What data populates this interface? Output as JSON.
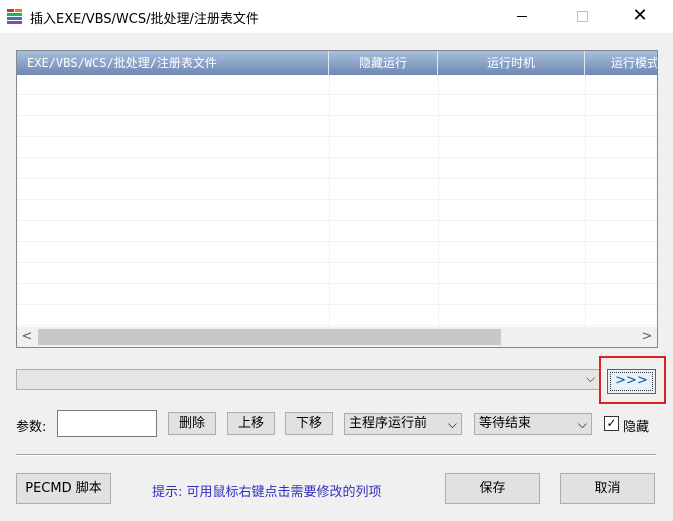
{
  "window": {
    "title": "插入EXE/VBS/WCS/批处理/注册表文件",
    "icon": "app-file-stack-icon",
    "controls": {
      "minimize": "minimize-icon",
      "maximize": "maximize-icon",
      "close": "close-icon",
      "close_glyph": "✕"
    }
  },
  "list": {
    "columns": [
      "EXE/VBS/WCS/批处理/注册表文件",
      "隐藏运行",
      "运行时机",
      "运行模式"
    ],
    "rows": [],
    "header_color": "#6d87b3",
    "scroll_left": "<",
    "scroll_right": ">"
  },
  "path": {
    "value": "",
    "arrow": "⌵"
  },
  "browse_button": {
    "label": ">>>"
  },
  "params": {
    "label": "参数:",
    "value": "",
    "delete_label": "删除",
    "move_up_label": "上移",
    "move_down_label": "下移",
    "timing_selected": "主程序运行前",
    "wait_selected": "等待结束",
    "combo_arrow": "⌵",
    "hide_label": "隐藏",
    "hide_checked": true,
    "check_glyph": "✓"
  },
  "footer": {
    "pecmd_label": "PECMD 脚本",
    "hint": "提示: 可用鼠标右键点击需要修改的列项",
    "hint_color": "#3030c0",
    "save_label": "保存",
    "cancel_label": "取消"
  },
  "accent": {
    "highlight_border": "#e02020",
    "focus_border": "#0078d7"
  }
}
